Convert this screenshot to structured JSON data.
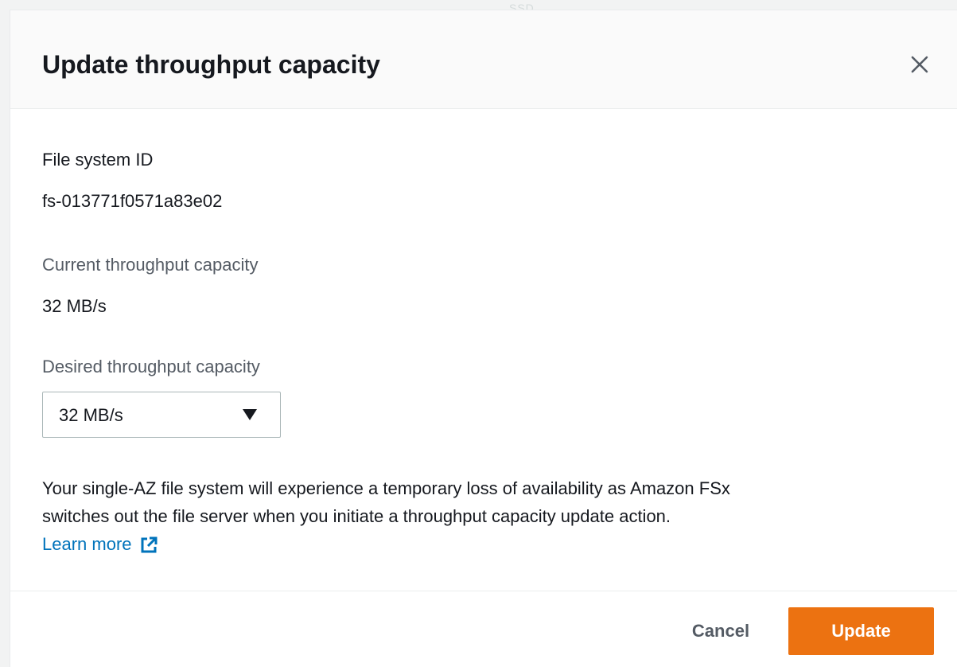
{
  "background": {
    "fragment_text": "SSD"
  },
  "modal": {
    "title": "Update throughput capacity",
    "close_icon": "close-icon",
    "fields": {
      "file_system_id": {
        "label": "File system ID",
        "value": "fs-013771f0571a83e02"
      },
      "current_throughput": {
        "label": "Current throughput capacity",
        "value": "32 MB/s"
      },
      "desired_throughput": {
        "label": "Desired throughput capacity",
        "selected": "32 MB/s",
        "caret_icon": "caret-down-icon"
      }
    },
    "notice": {
      "line1": "Your single-AZ file system will experience a temporary loss of availability as Amazon FSx",
      "line2": "switches out the file server when you initiate a throughput capacity update action.",
      "link_label": "Learn more",
      "link_icon": "external-link-icon"
    },
    "footer": {
      "cancel_label": "Cancel",
      "update_label": "Update"
    }
  },
  "colors": {
    "primary_button": "#ec7211",
    "link": "#0073bb",
    "text": "#16191f",
    "muted_text": "#545b64",
    "header_bg": "#fafafa",
    "border": "#aab7b8"
  }
}
